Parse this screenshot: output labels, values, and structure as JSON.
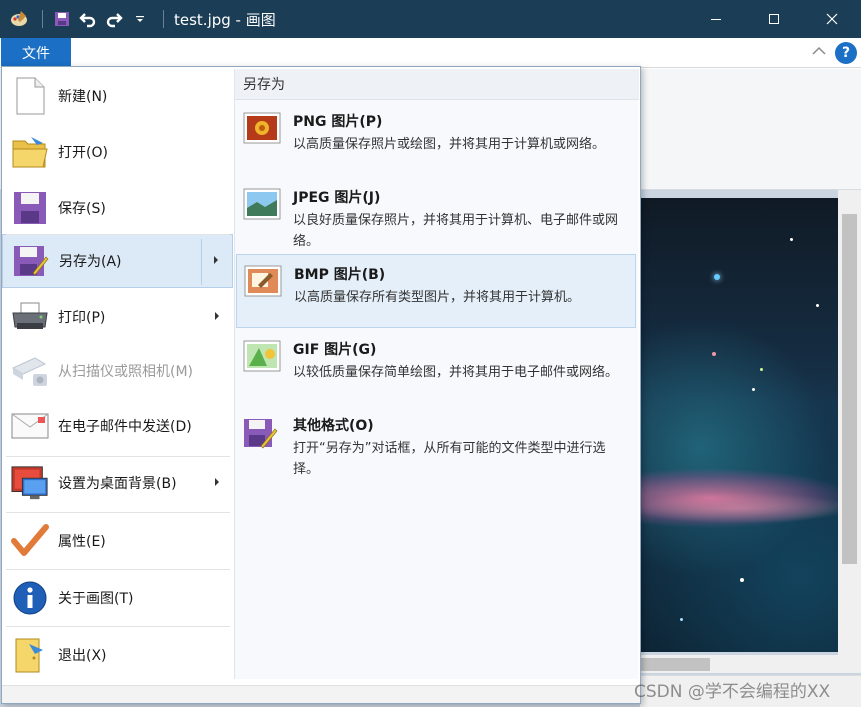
{
  "titlebar": {
    "title": "test.jpg - 画图",
    "icons": [
      "paint-app-icon",
      "save-icon",
      "undo-icon",
      "redo-icon",
      "customize-dropdown-icon"
    ],
    "window_controls": [
      "minimize",
      "maximize",
      "close"
    ]
  },
  "ribbon": {
    "file_tab": "文件",
    "help_label": "?"
  },
  "file_menu": {
    "items": [
      {
        "label": "新建(N)",
        "icon": "new-file-icon"
      },
      {
        "label": "打开(O)",
        "icon": "open-folder-icon"
      },
      {
        "label": "保存(S)",
        "icon": "floppy-disk-icon"
      },
      {
        "label": "另存为(A)",
        "icon": "save-as-icon",
        "selected": true,
        "submenu": true
      },
      {
        "label": "打印(P)",
        "icon": "printer-icon",
        "submenu": true
      },
      {
        "label": "从扫描仪或照相机(M)",
        "icon": "scanner-icon",
        "disabled": true
      },
      {
        "label": "在电子邮件中发送(D)",
        "icon": "email-icon"
      },
      {
        "label": "设置为桌面背景(B)",
        "icon": "desktop-background-icon",
        "submenu": true
      },
      {
        "label": "属性(E)",
        "icon": "properties-checkmark-icon"
      },
      {
        "label": "关于画图(T)",
        "icon": "info-icon"
      },
      {
        "label": "退出(X)",
        "icon": "exit-icon"
      }
    ]
  },
  "save_as_panel": {
    "heading": "另存为",
    "options": [
      {
        "title": "PNG 图片(P)",
        "desc": "以高质量保存照片或绘图，并将其用于计算机或网络。",
        "icon": "png-image-icon"
      },
      {
        "title": "JPEG 图片(J)",
        "desc": "以良好质量保存照片，并将其用于计算机、电子邮件或网络。",
        "icon": "jpeg-image-icon"
      },
      {
        "title": "BMP 图片(B)",
        "desc": "以高质量保存所有类型图片，并将其用于计算机。",
        "icon": "bmp-image-icon",
        "selected": true
      },
      {
        "title": "GIF 图片(G)",
        "desc": "以较低质量保存简单绘图，并将其用于电子邮件或网络。",
        "icon": "gif-image-icon"
      },
      {
        "title": "其他格式(O)",
        "desc": "打开“另存为”对话框，从所有可能的文件类型中进行选择。",
        "icon": "other-formats-icon"
      }
    ]
  },
  "watermark": "CSDN @学不会编程的XX"
}
